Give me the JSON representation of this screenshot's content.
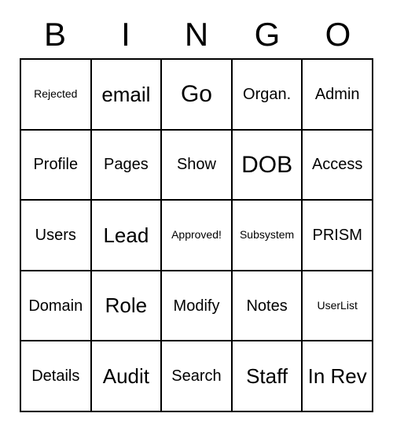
{
  "header": [
    "B",
    "I",
    "N",
    "G",
    "O"
  ],
  "grid": [
    [
      {
        "text": "Rejected",
        "size": "small"
      },
      {
        "text": "email",
        "size": "large"
      },
      {
        "text": "Go",
        "size": "xlarge"
      },
      {
        "text": "Organ.",
        "size": "med"
      },
      {
        "text": "Admin",
        "size": "med"
      }
    ],
    [
      {
        "text": "Profile",
        "size": "med"
      },
      {
        "text": "Pages",
        "size": "med"
      },
      {
        "text": "Show",
        "size": "med"
      },
      {
        "text": "DOB",
        "size": "xlarge"
      },
      {
        "text": "Access",
        "size": "med"
      }
    ],
    [
      {
        "text": "Users",
        "size": "med"
      },
      {
        "text": "Lead",
        "size": "large"
      },
      {
        "text": "Approved!",
        "size": "small"
      },
      {
        "text": "Subsystem",
        "size": "small"
      },
      {
        "text": "PRISM",
        "size": "med"
      }
    ],
    [
      {
        "text": "Domain",
        "size": "med"
      },
      {
        "text": "Role",
        "size": "large"
      },
      {
        "text": "Modify",
        "size": "med"
      },
      {
        "text": "Notes",
        "size": "med"
      },
      {
        "text": "UserList",
        "size": "small"
      }
    ],
    [
      {
        "text": "Details",
        "size": "med"
      },
      {
        "text": "Audit",
        "size": "large"
      },
      {
        "text": "Search",
        "size": "med"
      },
      {
        "text": "Staff",
        "size": "large"
      },
      {
        "text": "In Rev",
        "size": "large"
      }
    ]
  ]
}
